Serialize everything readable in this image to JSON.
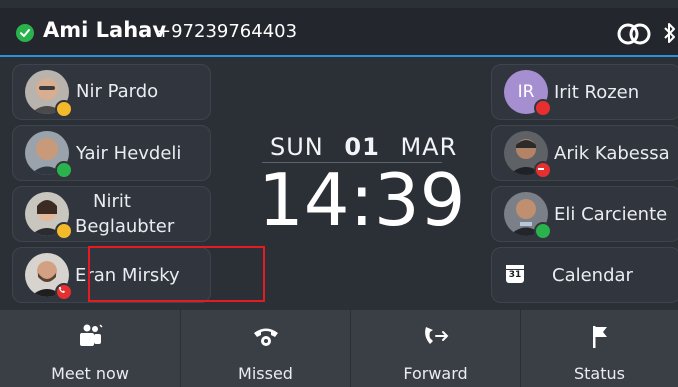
{
  "header": {
    "user_name": "Ami Lahav",
    "user_number": "+97239764403",
    "presence": "available",
    "icons": [
      "checkmark-icon",
      "linked-rings-icon",
      "bluetooth-icon"
    ]
  },
  "clock": {
    "weekday": "SUN",
    "day": "01",
    "month": "MAR",
    "time": "14:39"
  },
  "left_contacts": [
    {
      "name": "Nir Pardo",
      "presence": "away"
    },
    {
      "name": "Yair Hevdeli",
      "presence": "available"
    },
    {
      "name_line1": "Nirit",
      "name_line2": "Beglaubter",
      "presence": "away"
    },
    {
      "name": "Eran Mirsky",
      "presence": "on-call"
    }
  ],
  "right_contacts": [
    {
      "name": "Irit Rozen",
      "initials": "IR",
      "presence": "busy"
    },
    {
      "name": "Arik Kabessa",
      "presence": "do-not-disturb"
    },
    {
      "name": "Eli Carciente",
      "presence": "available"
    },
    {
      "name": "Calendar",
      "icon_day": "31",
      "icon": "calendar-icon"
    }
  ],
  "softkeys": [
    {
      "label": "Meet now",
      "icon": "teams-icon"
    },
    {
      "label": "Missed",
      "icon": "phone-handset-icon"
    },
    {
      "label": "Forward",
      "icon": "call-forward-icon"
    },
    {
      "label": "Status",
      "icon": "flag-icon"
    }
  ],
  "colors": {
    "accent": "#2f8fd9",
    "available": "#2ab24d",
    "away": "#f2b92a",
    "busy": "#e5302f",
    "focus": "#e31b23"
  }
}
